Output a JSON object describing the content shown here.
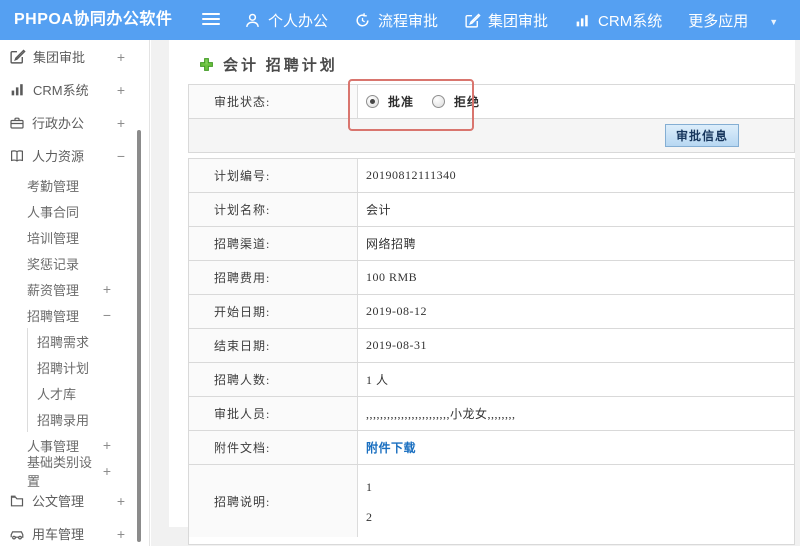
{
  "navbar": {
    "brand": "PHPOA协同办公软件",
    "items": [
      {
        "key": "personal-office",
        "label": "个人办公",
        "icon": "user-icon"
      },
      {
        "key": "process-approval",
        "label": "流程审批",
        "icon": "process-icon"
      },
      {
        "key": "group-approval",
        "label": "集团审批",
        "icon": "edit-square-icon"
      },
      {
        "key": "crm-system",
        "label": "CRM系统",
        "icon": "bar-chart-icon"
      },
      {
        "key": "more-apps",
        "label": "更多应用",
        "icon": "caret-down-icon"
      }
    ],
    "bg_color": "#55a0f2"
  },
  "sidebar": {
    "items": [
      {
        "key": "group-approval",
        "label": "集团审批",
        "level": 1,
        "icon": "edit-square-icon",
        "toggle": "+"
      },
      {
        "key": "crm-system",
        "label": "CRM系统",
        "level": 1,
        "icon": "bar-chart-icon",
        "toggle": "+"
      },
      {
        "key": "admin-office",
        "label": "行政办公",
        "level": 1,
        "icon": "briefcase-icon",
        "toggle": "+"
      },
      {
        "key": "human-resources",
        "label": "人力资源",
        "level": 1,
        "icon": "book-icon",
        "toggle": "−"
      },
      {
        "key": "attendance-mgmt",
        "label": "考勤管理",
        "level": 2
      },
      {
        "key": "hr-contract",
        "label": "人事合同",
        "level": 2
      },
      {
        "key": "training-mgmt",
        "label": "培训管理",
        "level": 2
      },
      {
        "key": "reward-punish",
        "label": "奖惩记录",
        "level": 2
      },
      {
        "key": "salary-mgmt",
        "label": "薪资管理",
        "level": 2,
        "toggle": "+"
      },
      {
        "key": "recruit-mgmt",
        "label": "招聘管理",
        "level": 2,
        "toggle": "−"
      },
      {
        "key": "recruit-demand",
        "label": "招聘需求",
        "level": 3
      },
      {
        "key": "recruit-plan",
        "label": "招聘计划",
        "level": 3
      },
      {
        "key": "talent-pool",
        "label": "人才库",
        "level": 3
      },
      {
        "key": "recruit-hire",
        "label": "招聘录用",
        "level": 3
      },
      {
        "key": "personnel-mgmt",
        "label": "人事管理",
        "level": 2,
        "toggle": "+"
      },
      {
        "key": "base-category",
        "label": "基础类别设置",
        "level": 2,
        "toggle": "+"
      },
      {
        "key": "document-mgmt",
        "label": "公文管理",
        "level": 1,
        "icon": "document-icon",
        "toggle": "+"
      },
      {
        "key": "vehicle-mgmt",
        "label": "用车管理",
        "level": 1,
        "icon": "car-icon",
        "toggle": "+"
      }
    ]
  },
  "main": {
    "title": "会计 招聘计划",
    "title_icon": "green-plus-icon",
    "approval": {
      "label": "审批状态:",
      "options": [
        {
          "label": "批准",
          "selected": true
        },
        {
          "label": "拒绝",
          "selected": false
        }
      ],
      "button_label": "审批信息"
    },
    "detail_rows": [
      {
        "key": "plan-number",
        "label": "计划编号:",
        "value": "20190812111340"
      },
      {
        "key": "plan-name",
        "label": "计划名称:",
        "value": "会计"
      },
      {
        "key": "recruit-channel",
        "label": "招聘渠道:",
        "value": "网络招聘"
      },
      {
        "key": "recruit-cost",
        "label": "招聘费用:",
        "value": "100 RMB"
      },
      {
        "key": "start-date",
        "label": "开始日期:",
        "value": "2019-08-12"
      },
      {
        "key": "end-date",
        "label": "结束日期:",
        "value": "2019-08-31"
      },
      {
        "key": "recruit-headcount",
        "label": "招聘人数:",
        "value": "1 人"
      },
      {
        "key": "approvers",
        "label": "审批人员:",
        "value": ",,,,,,,,,,,,,,,,,,,,,,,,小龙女,,,,,,,,"
      },
      {
        "key": "attachment-doc",
        "label": "附件文档:",
        "value": "附件下载",
        "type": "link"
      },
      {
        "key": "recruit-note",
        "label": "招聘说明:",
        "value": "1\n2",
        "type": "multiline"
      }
    ],
    "annotation_color": "#d9756e",
    "link_color": "#1a6fc0"
  }
}
